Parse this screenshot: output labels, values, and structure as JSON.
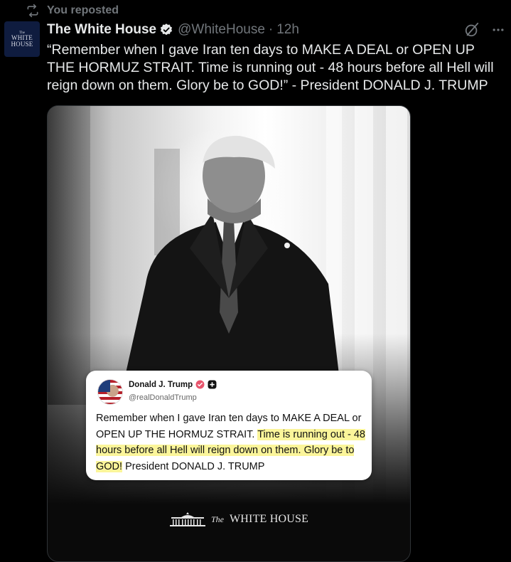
{
  "repost": {
    "label": "You reposted"
  },
  "account": {
    "avatar_lines": [
      "The",
      "WHITE",
      "HOUSE"
    ],
    "name": "The White House",
    "handle": "@WhiteHouse",
    "separator": "·",
    "time": "12h",
    "verified_color": "#e7e9ea"
  },
  "tweet": {
    "text": "“Remember when I gave Iran ten days to MAKE A DEAL or OPEN UP THE HORMUZ STRAIT. Time is running out - 48 hours before all Hell will reign down on them. Glory be to GOD!” - President DONALD J. TRUMP"
  },
  "quote_card": {
    "name": "Donald J. Trump",
    "handle": "@realDonaldTrump",
    "text_plain_1": "Remember when I gave Iran ten days to MAKE A DEAL or OPEN UP THE HORMUZ STRAIT. ",
    "text_highlight": "Time is running out - 48 hours before all Hell will reign down on them. Glory be to GOD!",
    "text_plain_2": " President DONALD J. TRUMP",
    "highlight_color": "#fbf59a",
    "badge_color": "#e8556d"
  },
  "watermark": {
    "prefix": "The",
    "name": "WHITE HOUSE"
  },
  "icons": {
    "repost": "repost-icon",
    "verified": "verified-badge-icon",
    "grok": "grok-icon",
    "more": "more-icon"
  },
  "colors": {
    "background": "#000000",
    "muted": "#71767b",
    "text": "#e7e9ea"
  }
}
